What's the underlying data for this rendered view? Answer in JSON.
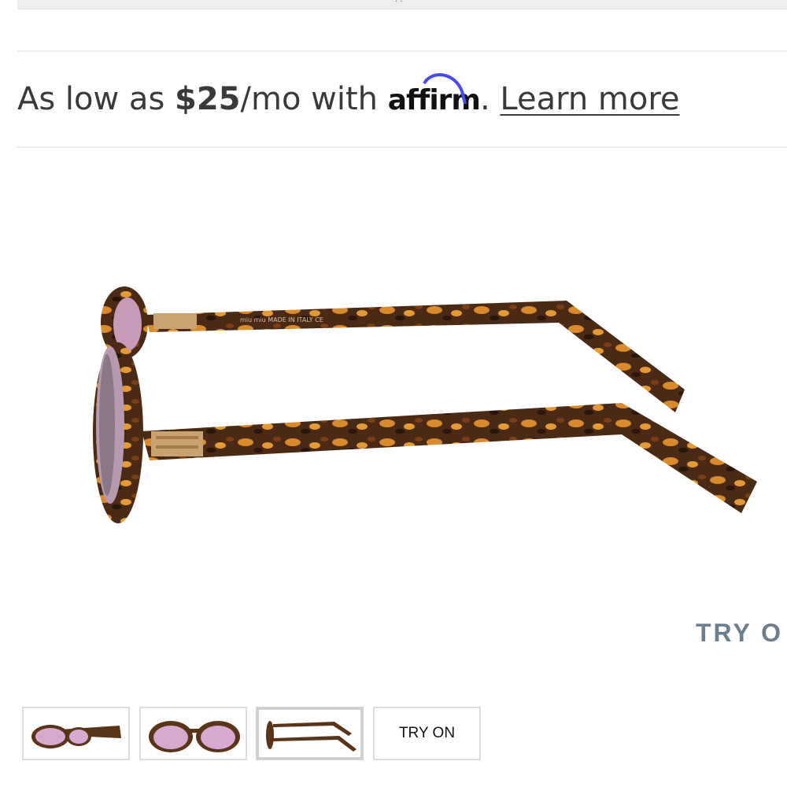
{
  "affirm": {
    "prefix": "As low as ",
    "amount": "$25",
    "suffix": "/mo with ",
    "logo_text": "affirm",
    "period": ".",
    "learn_more": "Learn more",
    "logo_arc_color": "#4a4af4"
  },
  "gallery": {
    "try_on_overlay": "TRY O",
    "thumbnails": [
      {
        "name": "thumb-side-angle",
        "icon": "glasses-angle-icon"
      },
      {
        "name": "thumb-front",
        "icon": "glasses-front-icon"
      },
      {
        "name": "thumb-side",
        "icon": "glasses-side-icon",
        "selected": true
      },
      {
        "name": "thumb-try-on",
        "label": "TRY ON"
      }
    ]
  },
  "product": {
    "temple_text": "miu miu MADE IN ITALY  CE",
    "colors": {
      "frame": "#4a2a14",
      "tortoise_light": "#d98a2a",
      "lens": "#d9a8cf"
    }
  }
}
